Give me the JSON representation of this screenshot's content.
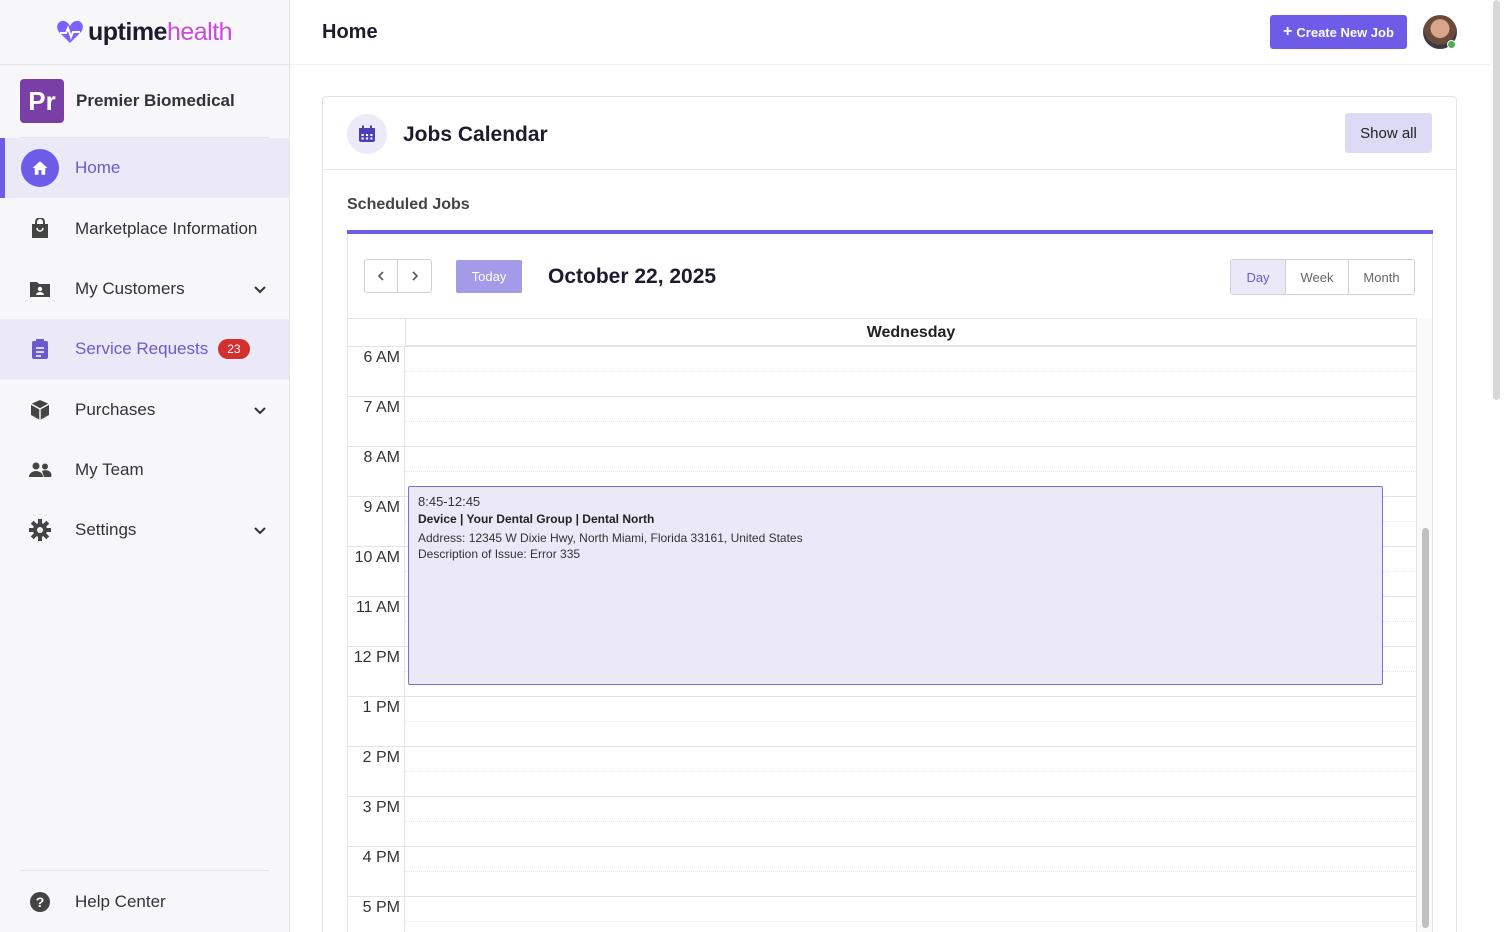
{
  "brand": {
    "name_part1": "uptime",
    "name_part2": "health"
  },
  "organization": {
    "initials": "Pr",
    "name": "Premier Biomedical"
  },
  "sidebar": {
    "items": [
      {
        "label": "Home",
        "icon": "home-icon"
      },
      {
        "label": "Marketplace Information",
        "icon": "shopping-bag-icon"
      },
      {
        "label": "My Customers",
        "icon": "folder-user-icon"
      },
      {
        "label": "Service Requests",
        "icon": "clipboard-icon",
        "badge": "23"
      },
      {
        "label": "Purchases",
        "icon": "package-icon"
      },
      {
        "label": "My Team",
        "icon": "people-icon"
      },
      {
        "label": "Settings",
        "icon": "gear-icon"
      }
    ],
    "help": {
      "label": "Help Center",
      "icon": "help-icon"
    }
  },
  "header": {
    "title": "Home",
    "create_label": "Create New Job"
  },
  "card": {
    "title": "Jobs Calendar",
    "show_all_label": "Show all",
    "section_label": "Scheduled Jobs"
  },
  "calendar": {
    "today_label": "Today",
    "date": "October 22, 2025",
    "views": [
      "Day",
      "Week",
      "Month"
    ],
    "active_view": "Day",
    "day_name": "Wednesday",
    "hours": [
      "6 AM",
      "7 AM",
      "8 AM",
      "9 AM",
      "10 AM",
      "11 AM",
      "12 PM",
      "1 PM",
      "2 PM",
      "3 PM",
      "4 PM",
      "5 PM"
    ],
    "event": {
      "time": "8:45-12:45",
      "title": "Device | Your Dental Group | Dental North",
      "address": "Address: 12345 W Dixie Hwy, North Miami, Florida 33161, United States",
      "description": "Description of Issue: Error 335"
    }
  },
  "colors": {
    "accent": "#6c5ce7",
    "badge": "#d32f2f",
    "event_bg": "#ebe9f8"
  }
}
